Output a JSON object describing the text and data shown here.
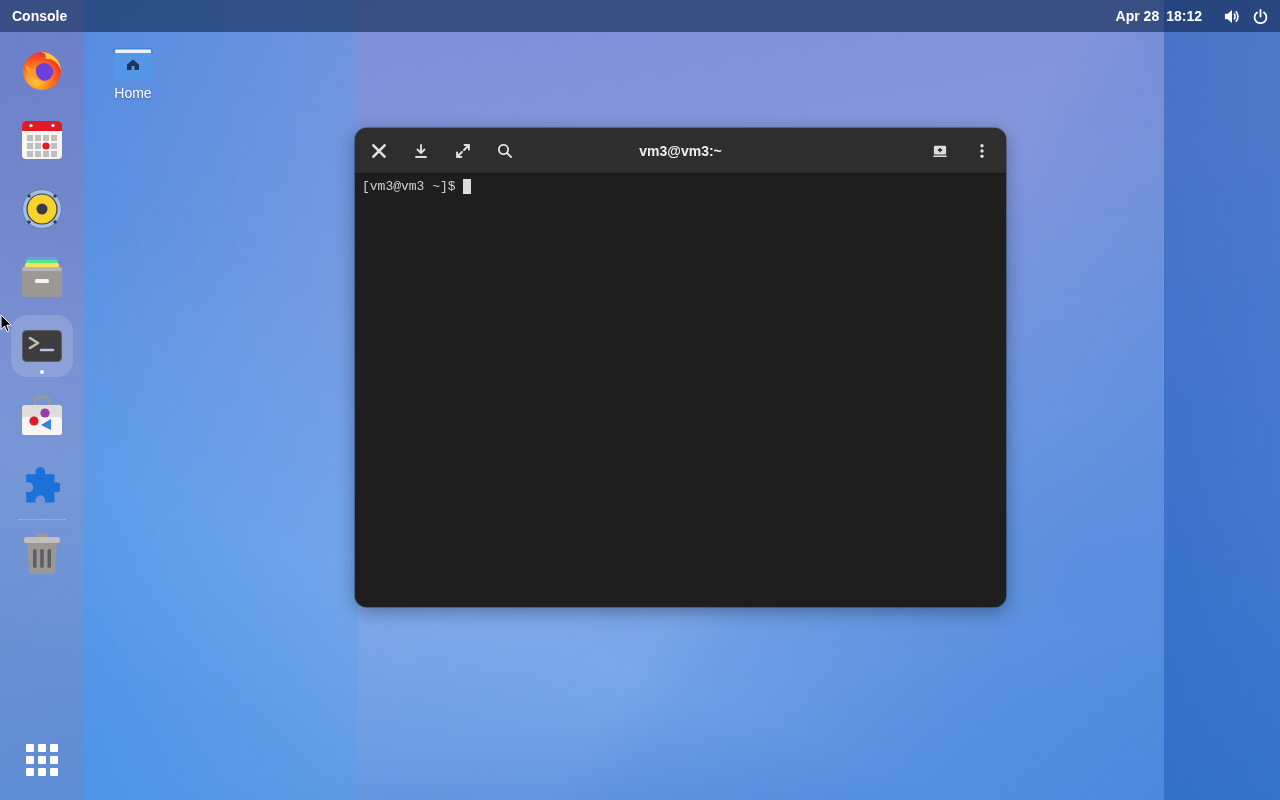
{
  "top_bar": {
    "app_menu": "Console",
    "date": "Apr 28",
    "time": "18:12"
  },
  "dock": {
    "items": [
      {
        "kind": "browser",
        "running": false,
        "highlighted": false
      },
      {
        "kind": "calendar",
        "running": false,
        "highlighted": false
      },
      {
        "kind": "speaker",
        "running": false,
        "highlighted": false
      },
      {
        "kind": "files",
        "running": false,
        "highlighted": false
      },
      {
        "kind": "terminal",
        "running": true,
        "highlighted": true
      },
      {
        "kind": "store",
        "running": false,
        "highlighted": false
      },
      {
        "kind": "extension",
        "running": false,
        "highlighted": false
      },
      {
        "kind": "trash",
        "running": false,
        "highlighted": false
      }
    ]
  },
  "desktop_icons": [
    {
      "label": "Home"
    }
  ],
  "window": {
    "title": "vm3@vm3:~",
    "prompt": "[vm3@vm3 ~]$"
  }
}
